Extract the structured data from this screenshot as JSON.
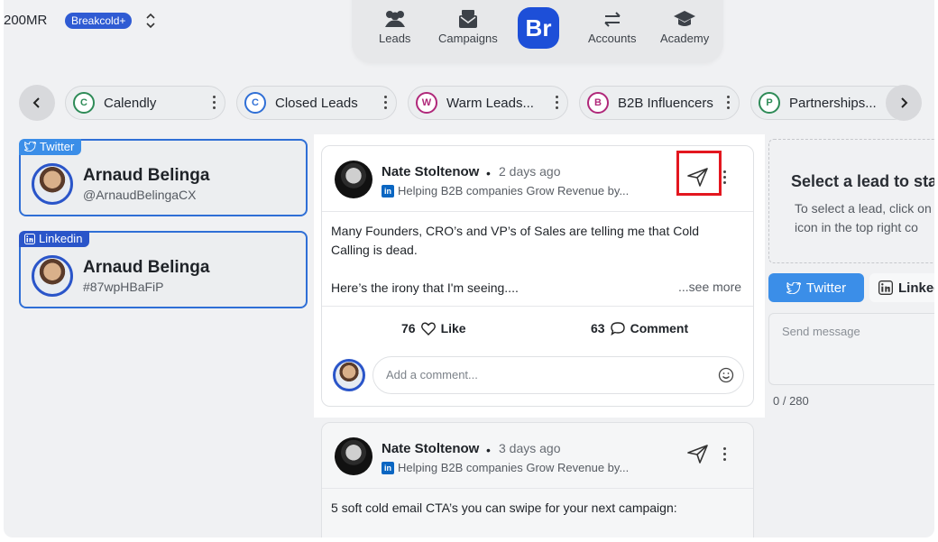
{
  "workspace": {
    "name": "200MR",
    "plan_badge": "Breakcold+"
  },
  "nav": {
    "items": [
      {
        "label": "Leads",
        "icon": "leads-icon"
      },
      {
        "label": "Campaigns",
        "icon": "campaigns-icon"
      },
      {
        "label": "Accounts",
        "icon": "accounts-icon"
      },
      {
        "label": "Academy",
        "icon": "academy-icon"
      }
    ],
    "logo": "Br"
  },
  "lists": [
    {
      "letter": "C",
      "label": "Calendly",
      "color": "#2e8b57"
    },
    {
      "letter": "C",
      "label": "Closed Leads",
      "color": "#2f6fd6"
    },
    {
      "letter": "W",
      "label": "Warm Leads...",
      "color": "#b0287a"
    },
    {
      "letter": "B",
      "label": "B2B Influencers",
      "color": "#b0287a"
    },
    {
      "letter": "P",
      "label": "Partnerships...",
      "color": "#2e8b57"
    }
  ],
  "leads": [
    {
      "network": "Twitter",
      "name": "Arnaud Belinga",
      "handle": "@ArnaudBelingaCX"
    },
    {
      "network": "Linkedin",
      "name": "Arnaud Belinga",
      "handle": "#87wpHBaFiP"
    }
  ],
  "right_panel": {
    "title": "Select a lead to sta",
    "desc_line1": "To select a lead, click on",
    "desc_line2": "icon in the top right co",
    "tab_twitter": "Twitter",
    "tab_linkedin": "Linked",
    "message_placeholder": "Send message",
    "counter": "0 / 280"
  },
  "posts": [
    {
      "author": "Nate Stoltenow",
      "ago": "2 days ago",
      "headline": "Helping B2B companies Grow Revenue by...",
      "body_p1": "Many Founders, CRO’s and VP’s of Sales are telling me that Cold Calling is dead.",
      "body_p2": "Here’s the irony that I'm seeing....",
      "see_more": "...see more",
      "likes": "76",
      "like_label": "Like",
      "comments": "63",
      "comment_label": "Comment",
      "comment_placeholder": "Add a comment..."
    },
    {
      "author": "Nate Stoltenow",
      "ago": "3 days ago",
      "headline": "Helping B2B companies Grow Revenue by...",
      "body_p1": "5 soft cold email CTA’s you can swipe for your next campaign:"
    }
  ]
}
